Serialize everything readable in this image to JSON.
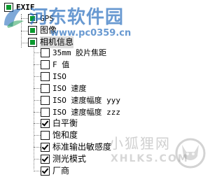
{
  "tree": {
    "root": {
      "label": "EXIF"
    },
    "level1": [
      {
        "label": "GPS"
      },
      {
        "label": "图像"
      },
      {
        "label": "相机信息"
      }
    ],
    "camera_items": [
      {
        "label": "35mm 胶片焦距",
        "checked": false
      },
      {
        "label": "F 值",
        "checked": false
      },
      {
        "label": "ISO",
        "checked": false
      },
      {
        "label": "ISO 速度",
        "checked": false
      },
      {
        "label": "ISO 速度幅度 yyy",
        "checked": false
      },
      {
        "label": "ISO 速度幅度 zzz",
        "checked": false
      },
      {
        "label": "白平衡",
        "checked": true
      },
      {
        "label": "饱和度",
        "checked": false
      },
      {
        "label": "标准输出敏感度",
        "checked": true
      },
      {
        "label": "测光模式",
        "checked": true
      },
      {
        "label": "厂商",
        "checked": true
      }
    ]
  },
  "watermark_top": {
    "title": "河东软件园",
    "url": "www.pc0359.cn"
  },
  "watermark_bottom": {
    "title": "小狐狸网",
    "subtitle": "XHLKS.COM"
  },
  "colors": {
    "watermark_blue": "#286ebe",
    "indeterminate_green": "#0b9a2e"
  }
}
